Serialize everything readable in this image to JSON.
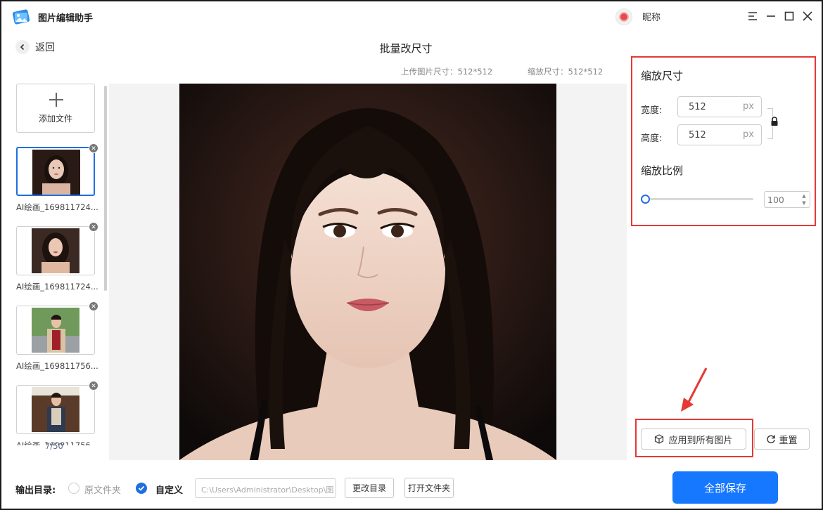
{
  "app": {
    "title": "图片编辑助手",
    "nickname": "昵称",
    "icons": [
      "app-logo-icon",
      "menu-icon",
      "minimize-icon",
      "maximize-icon",
      "close-icon"
    ]
  },
  "header": {
    "back_label": "返回",
    "page_title": "批量改尺寸",
    "upload_size": "上传图片尺寸：512*512",
    "scaled_size": "缩放尺寸：512*512"
  },
  "file_list": {
    "add_label": "添加文件",
    "items": [
      {
        "name": "AI绘画_169811724..."
      },
      {
        "name": "AI绘画_169811724..."
      },
      {
        "name": "AI绘画_169811756..."
      },
      {
        "name": "AI绘画_169811756..."
      }
    ],
    "counter": "7/50"
  },
  "settings": {
    "resize_title": "缩放尺寸",
    "width_label": "宽度:",
    "width_value": "512",
    "height_label": "高度:",
    "height_value": "512",
    "unit": "px",
    "ratio_title": "缩放比例",
    "ratio_value": "100"
  },
  "actions": {
    "apply_all": "应用到所有图片",
    "reset": "重置"
  },
  "output": {
    "label": "输出目录:",
    "original_folder": "原文件夹",
    "custom": "自定义",
    "path": "C:\\Users\\Administrator\\Desktop\\图",
    "change_dir": "更改目录",
    "open_folder": "打开文件夹",
    "save_all": "全部保存"
  },
  "colors": {
    "accent": "#1677ff",
    "highlight_border": "#e53935"
  }
}
